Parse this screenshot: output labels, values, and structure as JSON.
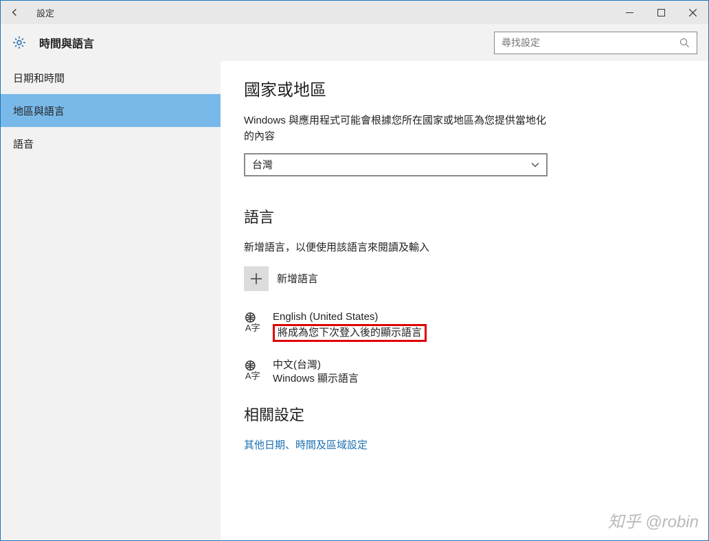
{
  "titlebar": {
    "title": "設定"
  },
  "header": {
    "title": "時間與語言",
    "search_placeholder": "尋找設定"
  },
  "sidebar": {
    "items": [
      {
        "label": "日期和時間"
      },
      {
        "label": "地區與語言"
      },
      {
        "label": "語音"
      }
    ]
  },
  "region": {
    "heading": "國家或地區",
    "desc": "Windows 與應用程式可能會根據您所在國家或地區為您提供當地化的內容",
    "value": "台灣"
  },
  "language": {
    "heading": "語言",
    "hint": "新增語言，以便使用該語言來閱讀及輸入",
    "add_label": "新增語言",
    "items": [
      {
        "name": "English (United States)",
        "sub": "將成為您下次登入後的顯示語言",
        "highlighted": true
      },
      {
        "name": "中文(台灣)",
        "sub": "Windows 顯示語言",
        "highlighted": false
      }
    ]
  },
  "related": {
    "heading": "相關設定",
    "link": "其他日期、時間及區域設定"
  },
  "watermark": "知乎 @robin"
}
